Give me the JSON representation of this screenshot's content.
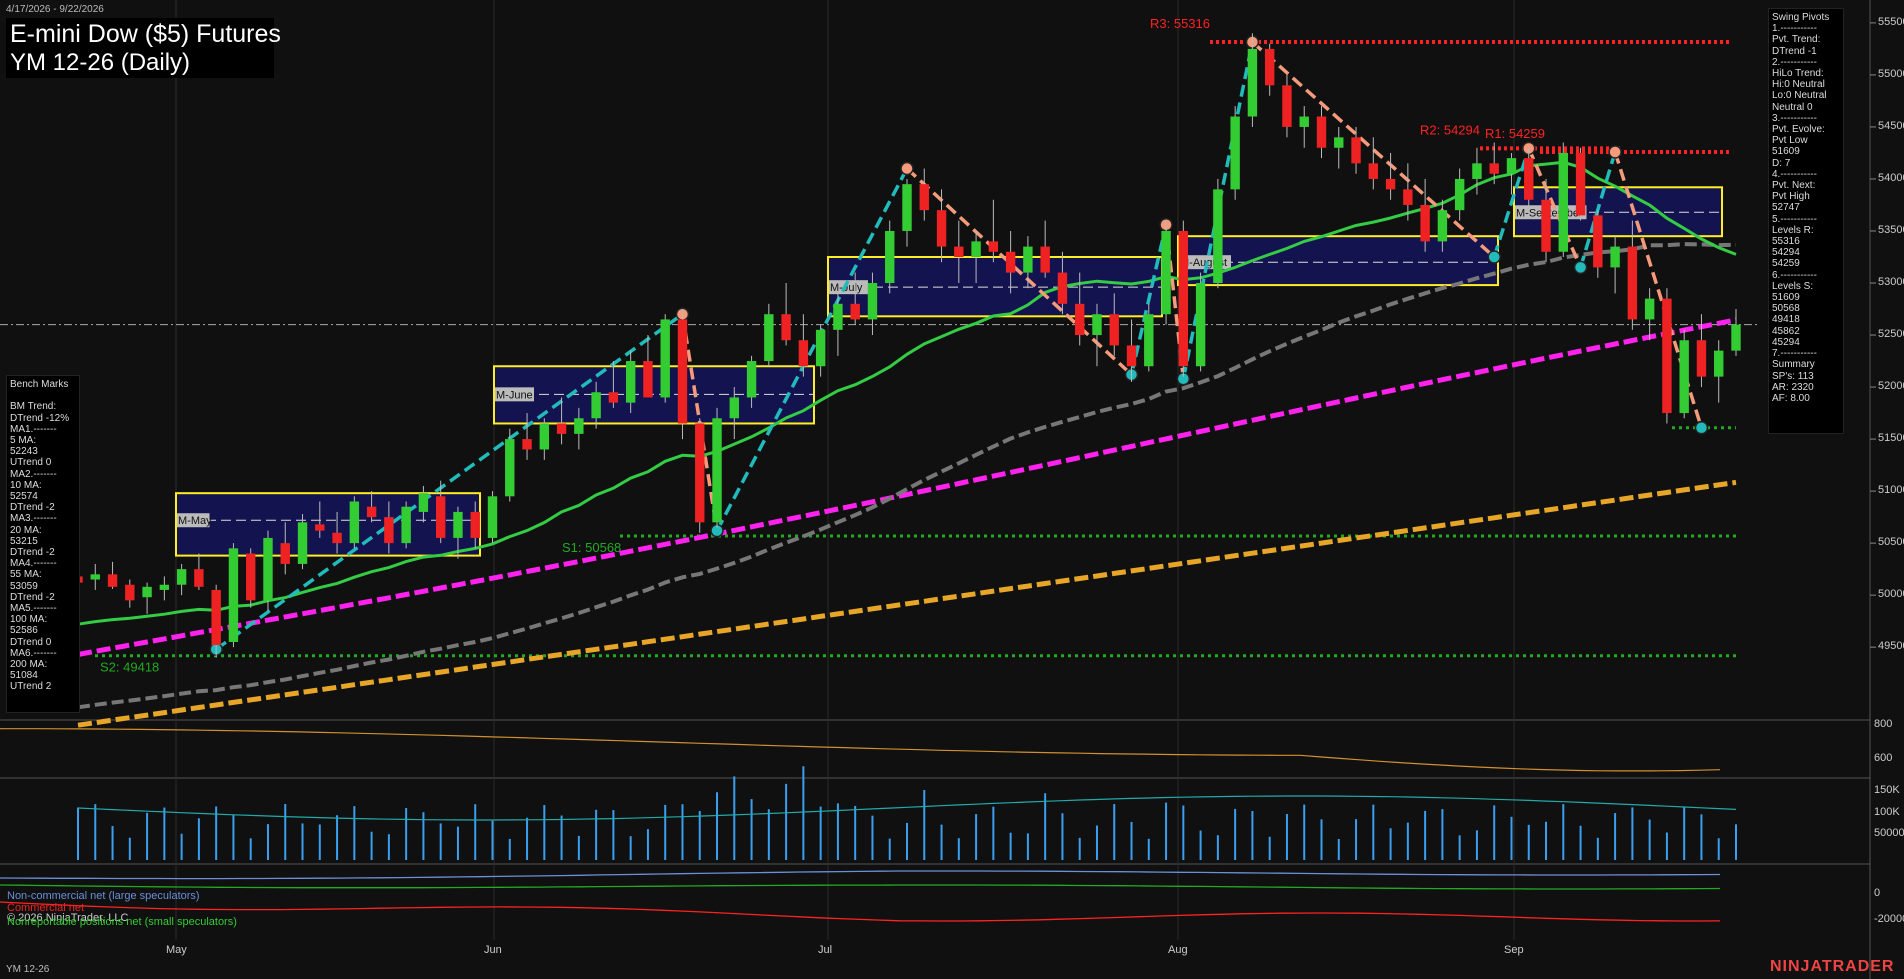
{
  "header": {
    "range": "4/17/2026 - 9/22/2026",
    "title": "E-mini Dow ($5) Futures",
    "subtitle": "YM 12-26 (Daily)",
    "symbol_footer": "YM 12-26",
    "brand": "NINJATRADER"
  },
  "colors": {
    "bull": "#33cc33",
    "bear": "#ee2222",
    "teal": "#22bbbb",
    "salmon": "#f59a7a",
    "magenta": "#ff22ee",
    "gold": "#e8a628",
    "gray_ma": "#777777",
    "green_ma": "#33cc44",
    "r_line": "#ff2222",
    "s_line": "#22aa22",
    "box_fill": "#14145a",
    "box_border": "#ffee22"
  },
  "swing_pivots": {
    "lines": [
      "Swing Pivots",
      "1.-----------",
      "Pvt. Trend:",
      "DTrend -1",
      "2.-----------",
      "HiLo Trend:",
      "Hi:0 Neutral",
      "Lo:0 Neutral",
      "Neutral 0",
      "3.-----------",
      "Pvt. Evolve:",
      "Pvt Low",
      "51609",
      "D: 7",
      "4.-----------",
      "Pvt. Next:",
      "Pvt High",
      "52747",
      "5.-----------",
      "Levels R:",
      "55316",
      "54294",
      "54259",
      "6.-----------",
      "Levels S:",
      "51609",
      "50568",
      "49418",
      "45862",
      "45294",
      "7.-----------",
      "Summary",
      "SP's: 113",
      "AR: 2320",
      "AF: 8.00"
    ]
  },
  "bench_marks": {
    "lines": [
      "Bench Marks",
      "",
      "BM Trend:",
      "DTrend -12%",
      "MA1.-------",
      "5 MA:",
      "52243",
      "UTrend 0",
      "MA2.-------",
      "10 MA:",
      "52574",
      "DTrend -2",
      "MA3.-------",
      "20 MA:",
      "53215",
      "DTrend -2",
      "MA4.-------",
      "55 MA:",
      "53059",
      "DTrend -2",
      "MA5.-------",
      "100 MA:",
      "52586",
      "DTrend 0",
      "MA6.-------",
      "200 MA:",
      "51084",
      "UTrend 2"
    ]
  },
  "legend": {
    "noncommercial": "Non-commercial net (large speculators)",
    "commercial": "Commercial net",
    "copyright": "© 2026 NinjaTrader, LLC",
    "small": "Nonreportable positions net (small speculators)"
  },
  "chart_data": {
    "type": "candlestick",
    "title": "E-mini Dow ($5) Futures YM 12-26 (Daily)",
    "y_ticks": [
      49500,
      50000,
      50500,
      51000,
      51500,
      52000,
      52500,
      53000,
      53500,
      54000,
      54500,
      55000,
      55500
    ],
    "ylim": [
      48800,
      55720
    ],
    "x_months": [
      "May",
      "Jun",
      "Jul",
      "Aug",
      "Sep"
    ],
    "levels": [
      {
        "name": "R3",
        "label": "R3: 55316",
        "value": 55316
      },
      {
        "name": "R2",
        "label": "R2: 54294",
        "value": 54294
      },
      {
        "name": "R1",
        "label": "R1: 54259",
        "value": 54259
      },
      {
        "name": "S1",
        "label": "S1: 50568",
        "value": 50568
      },
      {
        "name": "S2",
        "label": "S2: 49418",
        "value": 49418
      },
      {
        "name": "S",
        "label": "",
        "value": 51609
      }
    ],
    "month_boxes": [
      {
        "label": "M-May",
        "high": 50980,
        "low": 50380,
        "mid": 50720
      },
      {
        "label": "M-June",
        "high": 52200,
        "low": 51650,
        "mid": 51930
      },
      {
        "label": "M-July",
        "high": 53250,
        "low": 52680,
        "mid": 52960
      },
      {
        "label": "M-August",
        "high": 53450,
        "low": 52980,
        "mid": 53200
      },
      {
        "label": "M-September",
        "high": 53920,
        "low": 53450,
        "mid": 53680
      }
    ],
    "ohlc": [
      [
        50180,
        50250,
        50020,
        50120
      ],
      [
        50150,
        50300,
        50050,
        50200
      ],
      [
        50200,
        50320,
        50060,
        50080
      ],
      [
        50100,
        50150,
        49880,
        49950
      ],
      [
        49980,
        50120,
        49820,
        50080
      ],
      [
        50050,
        50180,
        49950,
        50100
      ],
      [
        50100,
        50300,
        50000,
        50250
      ],
      [
        50250,
        50400,
        50050,
        50080
      ],
      [
        50050,
        50100,
        49400,
        49520
      ],
      [
        49550,
        50500,
        49500,
        50450
      ],
      [
        50400,
        50450,
        49880,
        49950
      ],
      [
        49950,
        50620,
        49850,
        50550
      ],
      [
        50500,
        50700,
        50200,
        50300
      ],
      [
        50300,
        50780,
        50250,
        50700
      ],
      [
        50680,
        50900,
        50550,
        50620
      ],
      [
        50600,
        50800,
        50400,
        50500
      ],
      [
        50500,
        50950,
        50450,
        50900
      ],
      [
        50850,
        51000,
        50700,
        50750
      ],
      [
        50750,
        50900,
        50400,
        50500
      ],
      [
        50500,
        50900,
        50450,
        50850
      ],
      [
        50800,
        51050,
        50700,
        50980
      ],
      [
        50950,
        51100,
        50500,
        50550
      ],
      [
        50550,
        50850,
        50350,
        50800
      ],
      [
        50800,
        50900,
        50450,
        50550
      ],
      [
        50550,
        51000,
        50500,
        50950
      ],
      [
        50950,
        51600,
        50900,
        51500
      ],
      [
        51500,
        51750,
        51300,
        51400
      ],
      [
        51400,
        51700,
        51300,
        51650
      ],
      [
        51650,
        51900,
        51450,
        51550
      ],
      [
        51550,
        51800,
        51400,
        51700
      ],
      [
        51700,
        52050,
        51600,
        51950
      ],
      [
        51950,
        52250,
        51800,
        51850
      ],
      [
        51850,
        52350,
        51750,
        52250
      ],
      [
        52250,
        52500,
        51900,
        51900
      ],
      [
        51900,
        52700,
        51850,
        52650
      ],
      [
        52650,
        52750,
        51500,
        51650
      ],
      [
        51650,
        51700,
        50600,
        50700
      ],
      [
        50700,
        51800,
        50650,
        51700
      ],
      [
        51700,
        52000,
        51500,
        51900
      ],
      [
        51900,
        52300,
        51800,
        52250
      ],
      [
        52250,
        52800,
        52200,
        52700
      ],
      [
        52700,
        53000,
        52400,
        52450
      ],
      [
        52450,
        52700,
        52100,
        52200
      ],
      [
        52200,
        52600,
        52100,
        52550
      ],
      [
        52550,
        52900,
        52300,
        52800
      ],
      [
        52800,
        53100,
        52600,
        52650
      ],
      [
        52650,
        53100,
        52500,
        53000
      ],
      [
        53000,
        53600,
        52900,
        53500
      ],
      [
        53500,
        54000,
        53350,
        53950
      ],
      [
        53950,
        54100,
        53600,
        53700
      ],
      [
        53700,
        53900,
        53200,
        53350
      ],
      [
        53350,
        53600,
        53000,
        53250
      ],
      [
        53250,
        53500,
        53000,
        53400
      ],
      [
        53400,
        53800,
        53200,
        53300
      ],
      [
        53300,
        53500,
        52900,
        53100
      ],
      [
        53100,
        53450,
        52950,
        53350
      ],
      [
        53350,
        53600,
        53050,
        53100
      ],
      [
        53100,
        53300,
        52700,
        52800
      ],
      [
        52800,
        53100,
        52400,
        52500
      ],
      [
        52500,
        52800,
        52200,
        52700
      ],
      [
        52700,
        52900,
        52300,
        52400
      ],
      [
        52400,
        52650,
        52050,
        52200
      ],
      [
        52200,
        52800,
        52150,
        52700
      ],
      [
        52700,
        53600,
        52600,
        53500
      ],
      [
        53500,
        53600,
        52100,
        52200
      ],
      [
        52200,
        53100,
        52150,
        53000
      ],
      [
        53000,
        54000,
        52950,
        53900
      ],
      [
        53900,
        54700,
        53800,
        54600
      ],
      [
        54600,
        55400,
        54500,
        55250
      ],
      [
        55250,
        55300,
        54800,
        54900
      ],
      [
        54900,
        55000,
        54400,
        54500
      ],
      [
        54500,
        54700,
        54300,
        54600
      ],
      [
        54600,
        54700,
        54200,
        54300
      ],
      [
        54300,
        54500,
        54100,
        54400
      ],
      [
        54400,
        54500,
        54050,
        54150
      ],
      [
        54150,
        54400,
        53900,
        54000
      ],
      [
        54000,
        54250,
        53800,
        53900
      ],
      [
        53900,
        54150,
        53600,
        53750
      ],
      [
        53750,
        54000,
        53300,
        53400
      ],
      [
        53400,
        53800,
        53300,
        53700
      ],
      [
        53700,
        54100,
        53600,
        54000
      ],
      [
        54000,
        54300,
        53850,
        54150
      ],
      [
        54150,
        54350,
        53950,
        54050
      ],
      [
        54050,
        54250,
        53850,
        54200
      ],
      [
        54200,
        54300,
        53700,
        53800
      ],
      [
        53800,
        54000,
        53200,
        53300
      ],
      [
        53300,
        54350,
        53250,
        54250
      ],
      [
        54250,
        54300,
        53600,
        53650
      ],
      [
        53650,
        53700,
        53050,
        53150
      ],
      [
        53150,
        53450,
        52900,
        53350
      ],
      [
        53350,
        53600,
        52550,
        52650
      ],
      [
        52650,
        52950,
        52450,
        52850
      ],
      [
        52850,
        52950,
        51650,
        51750
      ],
      [
        51750,
        52550,
        51700,
        52450
      ],
      [
        52450,
        52700,
        52000,
        52100
      ],
      [
        52100,
        52450,
        51850,
        52350
      ],
      [
        52350,
        52750,
        52300,
        52600
      ]
    ],
    "ma": {
      "ma20": {
        "name": "20 MA",
        "values_start_index": 8
      },
      "ma55": {
        "name": "55 MA"
      },
      "ma100": {
        "name": "100 MA"
      },
      "ma200": {
        "name": "200 MA"
      }
    },
    "panel1_ticks": [
      600,
      800
    ],
    "panel2_ticks": [
      "50000",
      "100K",
      "150K"
    ],
    "panel3_ticks": [
      -20000,
      0
    ]
  }
}
